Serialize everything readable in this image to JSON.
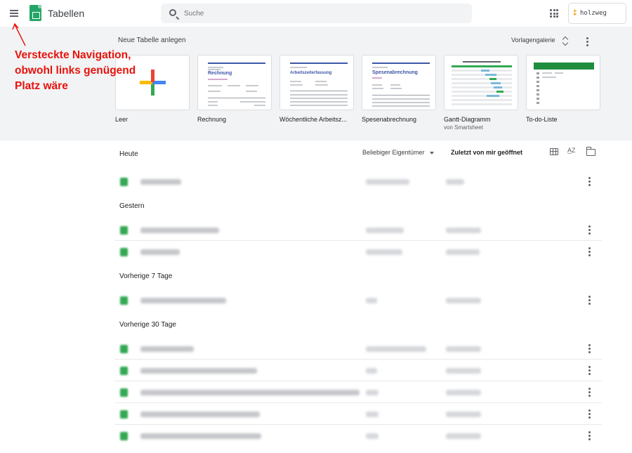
{
  "header": {
    "app_title": "Tabellen",
    "search_placeholder": "Suche",
    "account_name": "holzweg",
    "icons": [
      "menu-icon",
      "sheets-logo-icon",
      "search-icon",
      "apps-grid-icon"
    ]
  },
  "gallery": {
    "title": "Neue Tabelle anlegen",
    "link": "Vorlagengalerie",
    "templates": [
      {
        "name": "Leer",
        "sub": ""
      },
      {
        "name": "Rechnung",
        "sub": ""
      },
      {
        "name": "Wöchentliche Arbeitsz...",
        "sub": ""
      },
      {
        "name": "Spesenabrechnung",
        "sub": ""
      },
      {
        "name": "Gantt-Diagramm",
        "sub": "von Smartsheet"
      },
      {
        "name": "To-do-Liste",
        "sub": ""
      }
    ],
    "thumb_headings": {
      "rechnung": "Rechnung",
      "arbeitszeit": "Arbeitszeiterfassung",
      "spesen": "Spesenabrechnung"
    }
  },
  "files": {
    "owner_filter": "Beliebiger Eigentümer",
    "sort_label": "Zuletzt von mir geöffnet",
    "sort_icon_text": "A̲Z",
    "sections": [
      "Heute",
      "Gestern",
      "Vorherige 7 Tage",
      "Vorherige 30 Tage"
    ]
  },
  "annotation": {
    "lines": [
      "Versteckte Navigation,",
      "obwohl links genügend",
      "Platz wäre"
    ],
    "color": "#e8120c"
  },
  "colors": {
    "sheets_green": "#23a566",
    "gallery_bg": "#f1f3f4",
    "accent_blue": "#3c56a8"
  }
}
